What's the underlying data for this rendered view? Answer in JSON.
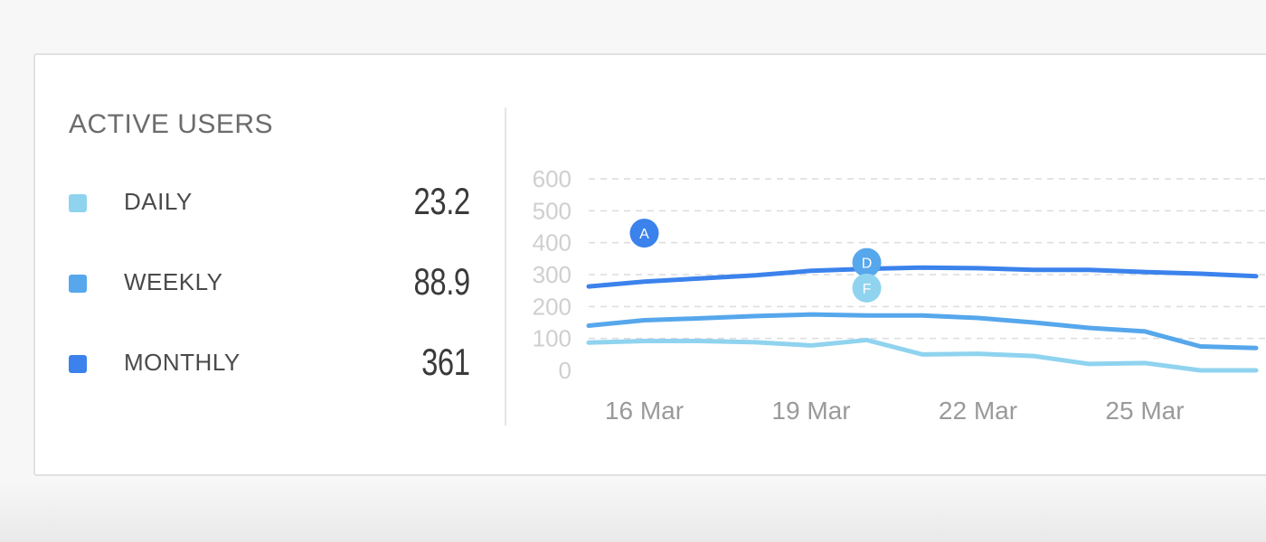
{
  "widget": {
    "title": "ACTIVE USERS"
  },
  "legend": [
    {
      "label": "DAILY",
      "value": "23.2",
      "color": "#8fd3ef"
    },
    {
      "label": "WEEKLY",
      "value": "88.9",
      "color": "#56a7ec"
    },
    {
      "label": "MONTHLY",
      "value": "361",
      "color": "#3b82ec"
    }
  ],
  "chart_data": {
    "type": "line",
    "x": [
      "15 Mar",
      "16 Mar",
      "17 Mar",
      "18 Mar",
      "19 Mar",
      "20 Mar",
      "21 Mar",
      "22 Mar",
      "23 Mar",
      "24 Mar",
      "25 Mar",
      "26 Mar",
      "27 Mar"
    ],
    "x_tick_labels": [
      "16 Mar",
      "19 Mar",
      "22 Mar",
      "25 Mar"
    ],
    "y_tick_labels": [
      "600",
      "500",
      "400",
      "300",
      "200",
      "100",
      "0"
    ],
    "ylim": [
      0,
      600
    ],
    "grid": true,
    "series": [
      {
        "name": "MONTHLY",
        "color": "#3b82ec",
        "values": [
          263,
          278,
          288,
          298,
          312,
          318,
          322,
          320,
          315,
          315,
          308,
          303,
          295
        ]
      },
      {
        "name": "WEEKLY",
        "color": "#56a7ec",
        "values": [
          140,
          157,
          163,
          170,
          175,
          172,
          172,
          164,
          150,
          133,
          122,
          75,
          70
        ]
      },
      {
        "name": "DAILY",
        "color": "#8fd3ef",
        "values": [
          87,
          92,
          92,
          88,
          78,
          95,
          50,
          52,
          45,
          20,
          23,
          0,
          0
        ]
      }
    ],
    "annotations": [
      {
        "label": "A",
        "x": "16 Mar",
        "y": 430,
        "color": "#3b82ec"
      },
      {
        "label": "D",
        "x": "20 Mar",
        "y": 338,
        "color": "#56a7ec"
      },
      {
        "label": "F",
        "x": "20 Mar",
        "y": 258,
        "color": "#8fd3ef"
      }
    ]
  }
}
